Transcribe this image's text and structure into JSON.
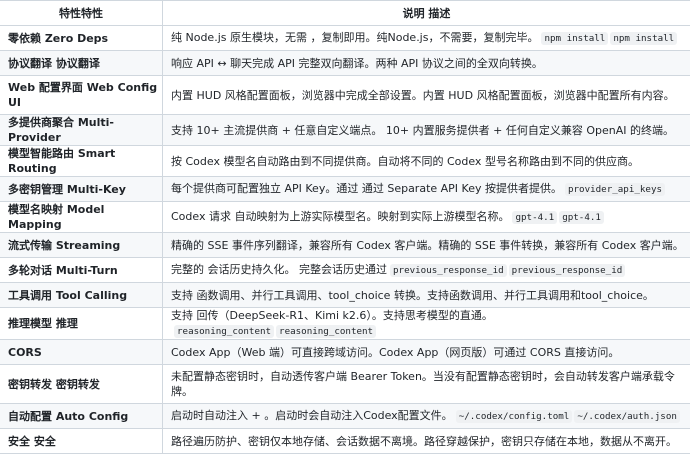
{
  "header": {
    "feature": "特性特性",
    "description": "说明 描述"
  },
  "rows": [
    {
      "feature": "零依赖 Zero Deps",
      "description": "纯 Node.js 原生模块，无需 ，复制即用。纯Node.js，不需要，复制完毕。",
      "codes": [
        "npm install",
        "npm install"
      ]
    },
    {
      "feature": "协议翻译 协议翻译",
      "description": "响应 API ↔ 聊天完成 API 完整双向翻译。两种 API 协议之间的全双向转换。",
      "codes": []
    },
    {
      "feature": "Web 配置界面 Web Config UI",
      "description": "内置 HUD 风格配置面板，浏览器中完成全部设置。内置 HUD 风格配置面板，浏览器中配置所有内容。",
      "codes": []
    },
    {
      "feature": "多提供商聚合 Multi-Provider",
      "description": "支持 10+ 主流提供商 + 任意自定义端点。 10+ 内置服务提供者 + 任何自定义兼容 OpenAI 的终端。",
      "codes": []
    },
    {
      "feature": "模型智能路由 Smart Routing",
      "description": "按 Codex 模型名自动路由到不同提供商。自动将不同的 Codex 型号名称路由到不同的供应商。",
      "codes": []
    },
    {
      "feature": "多密钥管理 Multi-Key",
      "description": "每个提供商可配置独立 API Key。通过 通过 Separate API Key 按提供者提供。",
      "codes": [
        "provider_api_keys"
      ]
    },
    {
      "feature": "模型名映射 Model Mapping",
      "description": "Codex 请求 自动映射为上游实际模型名。映射到实际上游模型名称。",
      "codes": [
        "gpt-4.1",
        "gpt-4.1"
      ]
    },
    {
      "feature": "流式传输 Streaming",
      "description": "精确的 SSE 事件序列翻译，兼容所有 Codex 客户端。精确的 SSE 事件转换，兼容所有 Codex 客户端。",
      "codes": []
    },
    {
      "feature": "多轮对话 Multi-Turn",
      "description": "完整的 会话历史持久化。 完整会话历史通过",
      "codes": [
        "previous_response_id",
        "previous_response_id"
      ]
    },
    {
      "feature": "工具调用 Tool Calling",
      "description": "支持 函数调用、并行工具调用、tool_choice 转换。支持函数调用、并行工具调用和tool_choice。",
      "codes": []
    },
    {
      "feature": "推理模型 推理",
      "description": "支持 回传（DeepSeek-R1、Kimi k2.6）。支持思考模型的直通。",
      "codes": [
        "reasoning_content",
        "reasoning_content"
      ]
    },
    {
      "feature": "CORS",
      "description": "Codex App（Web 端）可直接跨域访问。Codex App（网页版）可通过 CORS 直接访问。",
      "codes": []
    },
    {
      "feature": "密钥转发 密钥转发",
      "description": "未配置静态密钥时，自动透传客户端 Bearer Token。当没有配置静态密钥时，会自动转发客户端承载令牌。",
      "codes": []
    },
    {
      "feature": "自动配置 Auto Config",
      "description": "启动时自动注入 + 。启动时会自动注入Codex配置文件。",
      "codes": [
        "~/.codex/config.toml",
        "~/.codex/auth.json"
      ]
    },
    {
      "feature": "安全 安全",
      "description": "路径遍历防护、密钥仅本地存储、会话数据不离境。路径穿越保护，密钥只存储在本地，数据从不离开。",
      "codes": []
    }
  ]
}
